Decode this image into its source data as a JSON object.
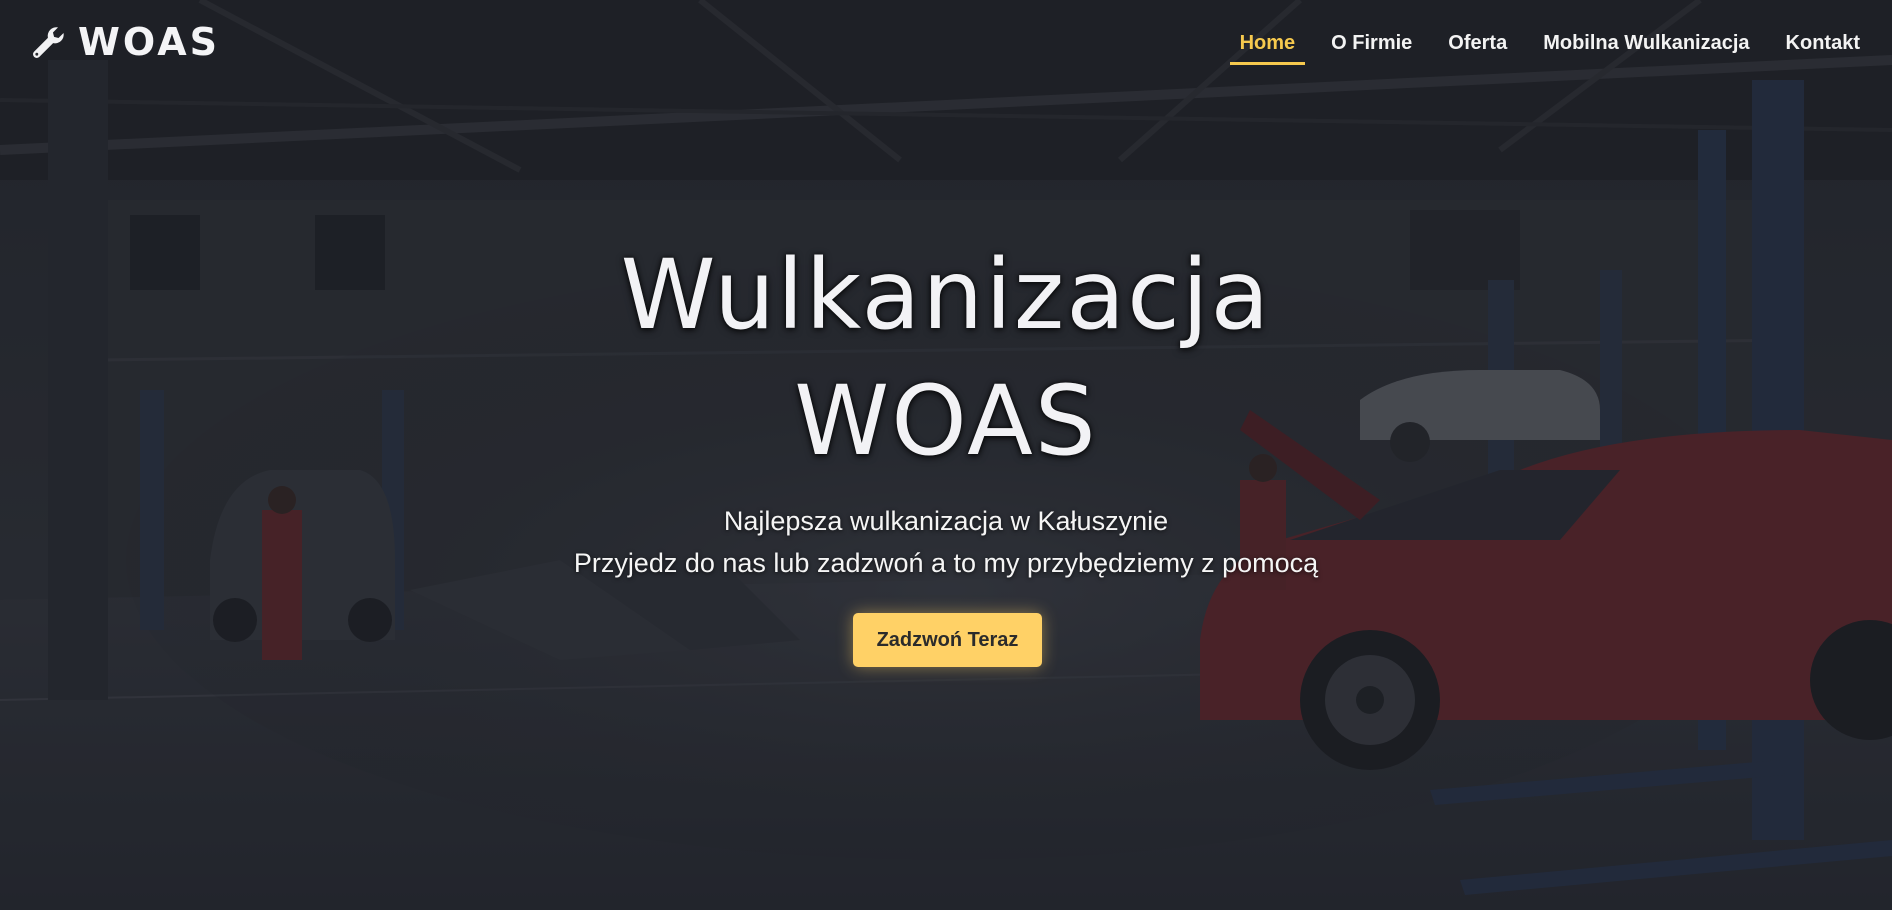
{
  "brand": {
    "name": "WOAS",
    "icon": "wrench-icon"
  },
  "nav": {
    "items": [
      {
        "label": "Home",
        "active": true
      },
      {
        "label": "O Firmie",
        "active": false
      },
      {
        "label": "Oferta",
        "active": false
      },
      {
        "label": "Mobilna Wulkanizacja",
        "active": false
      },
      {
        "label": "Kontakt",
        "active": false
      }
    ]
  },
  "hero": {
    "title_line1": "Wulkanizacja",
    "title_line2": "WOAS",
    "subtitle_line1": "Najlepsza wulkanizacja w Kałuszynie",
    "subtitle_line2": "Przyjedz do nas lub zadzwoń a to my przybędziemy z pomocą",
    "cta_label": "Zadzwoń Teraz"
  },
  "colors": {
    "accent": "#f6c94e",
    "button": "#ffd166",
    "text": "#f3f3f3"
  }
}
